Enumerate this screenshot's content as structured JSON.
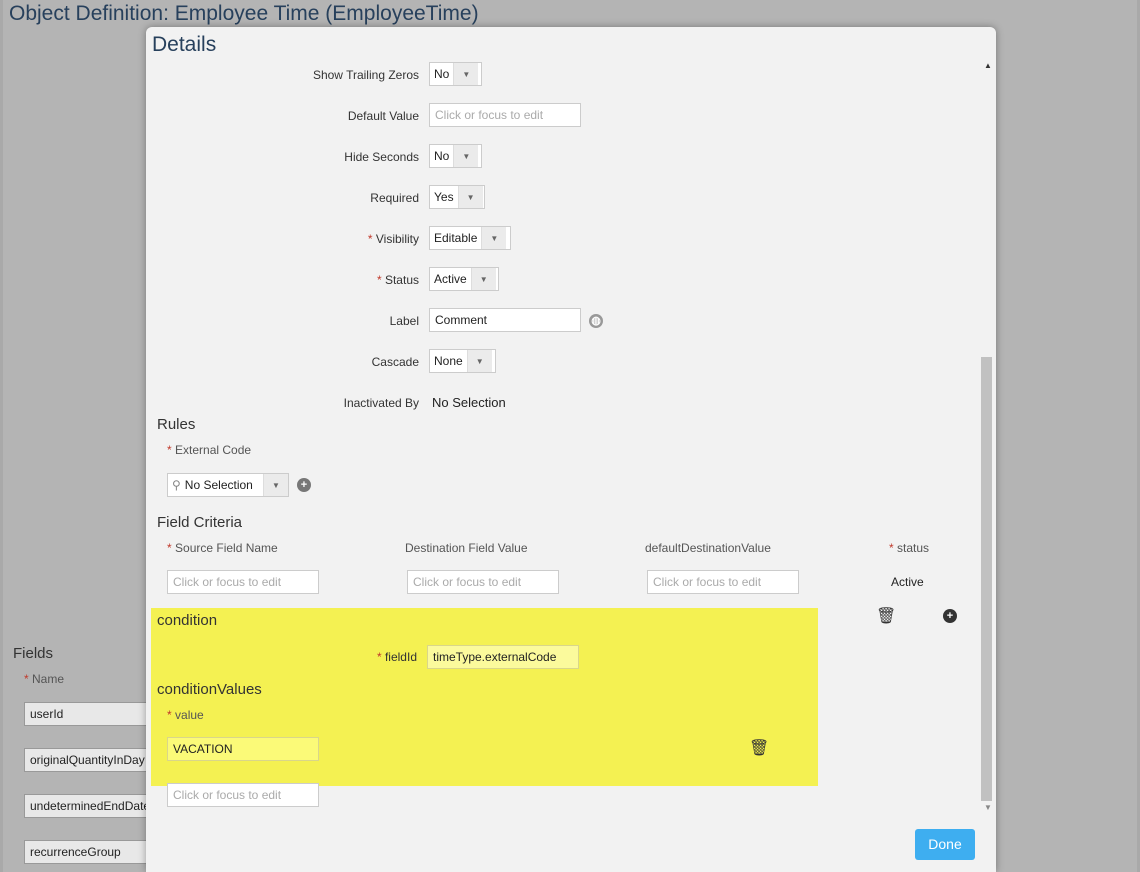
{
  "page_title": "Object Definition: Employee Time (EmployeeTime)",
  "fields_section": {
    "title": "Fields",
    "name_label": "Name",
    "rows": [
      "userId",
      "originalQuantityInDay",
      "undeterminedEndDate",
      "recurrenceGroup"
    ]
  },
  "dialog": {
    "title": "Details",
    "properties": [
      {
        "label": "Show Trailing Zeros",
        "value": "No"
      },
      {
        "label": "Default Value",
        "placeholder": "Click or focus to edit"
      },
      {
        "label": "Hide Seconds",
        "value": "No"
      },
      {
        "label": "Required",
        "value": "Yes"
      },
      {
        "label": "Visibility",
        "value": "Editable",
        "required": true
      },
      {
        "label": "Status",
        "value": "Active",
        "required": true
      },
      {
        "label": "Label",
        "value": "Comment"
      },
      {
        "label": "Cascade",
        "value": "None"
      },
      {
        "label": "Inactivated By",
        "value": "No Selection"
      }
    ],
    "rules": {
      "title": "Rules",
      "external_code_label": "External Code",
      "external_code_value": "No Selection"
    },
    "field_criteria": {
      "title": "Field Criteria",
      "columns": [
        "Source Field Name",
        "Destination Field Value",
        "defaultDestinationValue",
        "status"
      ],
      "placeholder": "Click or focus to edit",
      "status_value": "Active"
    },
    "condition": {
      "title": "condition",
      "fieldid_label": "fieldId",
      "fieldid_value": "timeType.externalCode",
      "values_title": "conditionValues",
      "value_label": "value",
      "value": "VACATION",
      "new_placeholder": "Click or focus to edit"
    },
    "done_label": "Done"
  },
  "colors": {
    "highlight": "#f4f152",
    "done_button": "#3eaef0",
    "title": "#27405c",
    "required_star": "#c0392b"
  }
}
